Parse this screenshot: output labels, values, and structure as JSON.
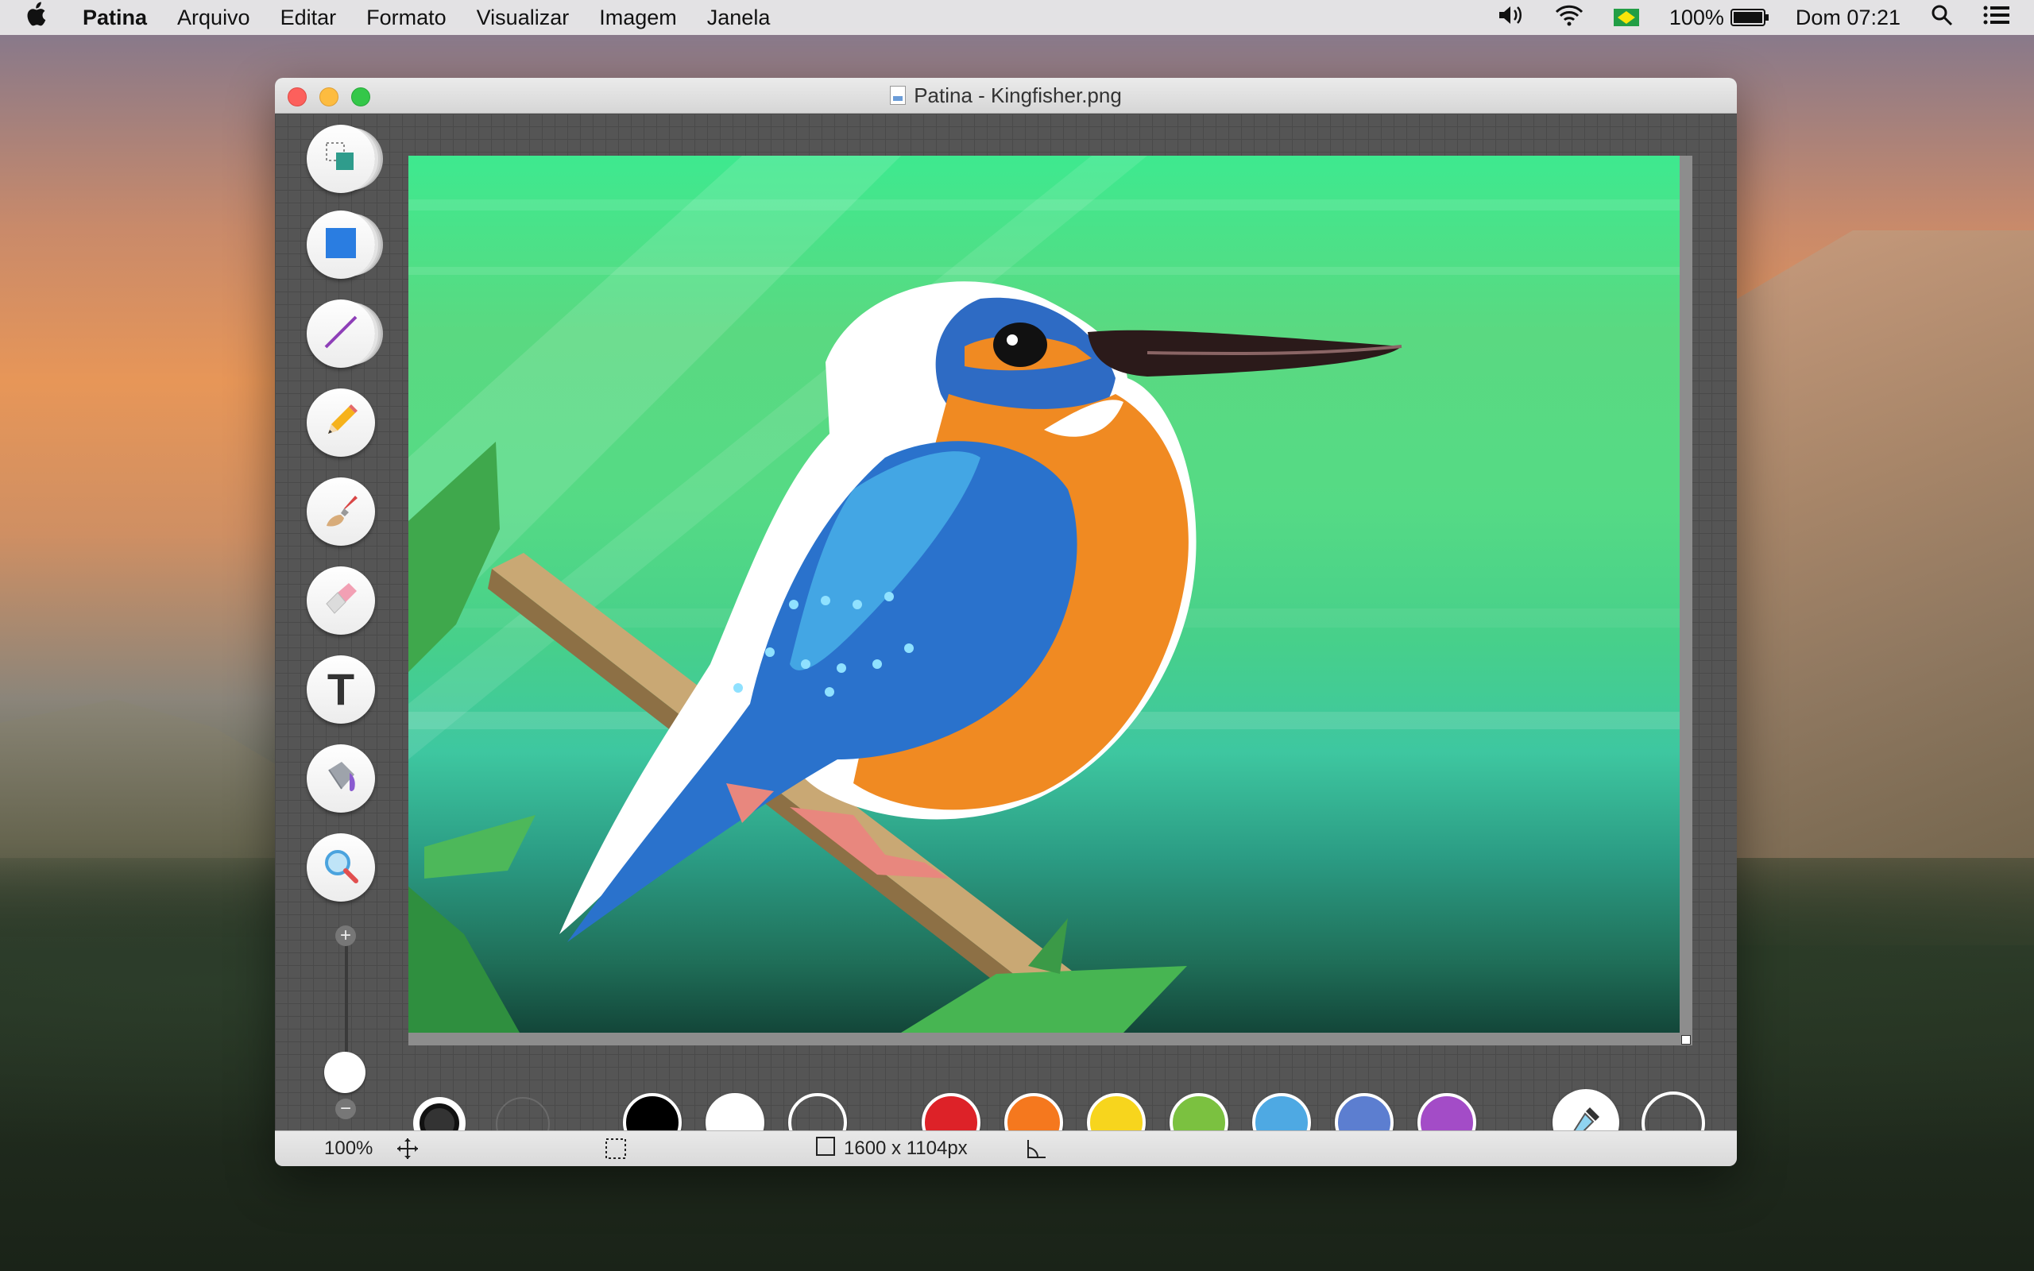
{
  "menubar": {
    "apple_icon": "apple-logo-icon",
    "app_name": "Patina",
    "items": [
      "Arquivo",
      "Editar",
      "Formato",
      "Visualizar",
      "Imagem",
      "Janela"
    ],
    "battery_percent": "100%",
    "clock": "Dom 07:21",
    "icons": [
      "volume-icon",
      "wifi-icon",
      "brazil-flag-icon",
      "battery-icon",
      "spotlight-search-icon",
      "notification-center-icon"
    ]
  },
  "window": {
    "title": "Patina - Kingfisher.png"
  },
  "tools": [
    {
      "name": "selection",
      "icon": "selection-tool-icon",
      "active": true
    },
    {
      "name": "shape",
      "icon": "square-shape-icon"
    },
    {
      "name": "line",
      "icon": "line-icon"
    },
    {
      "name": "pencil",
      "icon": "pencil-icon"
    },
    {
      "name": "brush",
      "icon": "brush-icon"
    },
    {
      "name": "eraser",
      "icon": "eraser-icon"
    },
    {
      "name": "text",
      "icon": "text-tool-icon",
      "glyph": "T"
    },
    {
      "name": "fill",
      "icon": "paint-bucket-icon"
    },
    {
      "name": "zoom",
      "icon": "magnifier-icon"
    }
  ],
  "zoom_slider": {
    "plus": "+",
    "minus": "−"
  },
  "palette": {
    "colors": [
      "#000000",
      "#ffffff",
      "transparent",
      "#dd2228",
      "#f5781e",
      "#f7d51d",
      "#7bc140",
      "#4ea9e3",
      "#5c7ed0",
      "#a34cc7"
    ],
    "picker_icon": "eyedropper-icon"
  },
  "statusbar": {
    "zoom": "100%",
    "dimensions": "1600 x 1104px",
    "icons": [
      "move-cursor-icon",
      "selection-marquee-icon",
      "canvas-size-icon",
      "angle-icon"
    ]
  }
}
